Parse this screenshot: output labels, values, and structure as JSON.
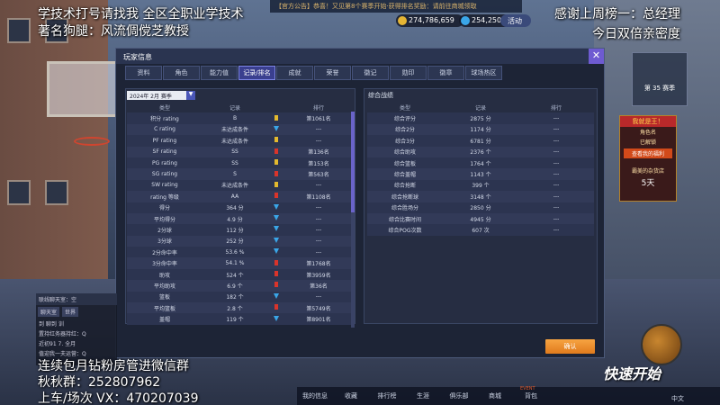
{
  "topbar": {
    "notice": "【官方公告】恭喜！又见第8个赛季开始·获得排名奖励：请前往商城领取",
    "coins": [
      {
        "value": "274,786,659"
      },
      {
        "value": "254,250"
      }
    ],
    "activity_label": "活动"
  },
  "overlays": {
    "top_left_1": "学技术打号请找我 全区全职业学技术",
    "top_left_2": "著名狗腿：风流倜傥芝教授",
    "top_right_1": "感谢上周榜一：总经理",
    "top_right_2": "今日双倍亲密度",
    "bottom_left_1": "连续包月钻粉房管进微信群",
    "bottom_left_2": "秋秋群：252807962",
    "bottom_left_3": "上车/场次 VX：470207039"
  },
  "modal": {
    "title": "玩家信息",
    "close": "✕",
    "tabs": [
      "资料",
      "角色",
      "能力值",
      "记录/排名",
      "成就",
      "荣誉",
      "徽记",
      "勋印",
      "徽章",
      "球场热区"
    ],
    "active_tab_index": 3,
    "season_select": "2024年 2月 赛季",
    "left_table": {
      "headers": [
        "类型",
        "记录",
        "排行"
      ],
      "rows": [
        {
          "type": "积分 rating",
          "record": "B",
          "indicator": "y",
          "rank": "第1061名"
        },
        {
          "type": "C rating",
          "record": "未达成条件",
          "indicator": "b",
          "rank": "---"
        },
        {
          "type": "PF rating",
          "record": "未达成条件",
          "indicator": "y",
          "rank": "---"
        },
        {
          "type": "SF rating",
          "record": "SS",
          "indicator": "r",
          "rank": "第136名"
        },
        {
          "type": "PG rating",
          "record": "SS",
          "indicator": "y",
          "rank": "第153名"
        },
        {
          "type": "SG rating",
          "record": "S",
          "indicator": "r",
          "rank": "第563名"
        },
        {
          "type": "SW rating",
          "record": "未达成条件",
          "indicator": "y",
          "rank": "---"
        },
        {
          "type": "rating 等级",
          "record": "AA",
          "indicator": "r",
          "rank": "第1108名"
        },
        {
          "type": "得分",
          "record": "364 分",
          "indicator": "b",
          "rank": "---"
        },
        {
          "type": "平均得分",
          "record": "4.9 分",
          "indicator": "b",
          "rank": "---"
        },
        {
          "type": "2分球",
          "record": "112 分",
          "indicator": "b",
          "rank": "---"
        },
        {
          "type": "3分球",
          "record": "252 分",
          "indicator": "b",
          "rank": "---"
        },
        {
          "type": "2分命中率",
          "record": "53.6 %",
          "indicator": "b",
          "rank": "---"
        },
        {
          "type": "3分命中率",
          "record": "54.1 %",
          "indicator": "r",
          "rank": "第1768名"
        },
        {
          "type": "助攻",
          "record": "524 个",
          "indicator": "r",
          "rank": "第3959名"
        },
        {
          "type": "平均助攻",
          "record": "6.9 个",
          "indicator": "r",
          "rank": "第36名"
        },
        {
          "type": "篮板",
          "record": "182 个",
          "indicator": "b",
          "rank": "---"
        },
        {
          "type": "平均篮板",
          "record": "2.8 个",
          "indicator": "r",
          "rank": "第5749名"
        },
        {
          "type": "盖帽",
          "record": "119 个",
          "indicator": "b",
          "rank": "第8901名"
        }
      ]
    },
    "right_panel_title": "综合战绩",
    "right_table": {
      "headers": [
        "类型",
        "记录",
        "排行"
      ],
      "rows": [
        {
          "type": "综合评分",
          "record": "2875 分",
          "rank": "---"
        },
        {
          "type": "综合2分",
          "record": "1174 分",
          "rank": "---"
        },
        {
          "type": "综合3分",
          "record": "6781 分",
          "rank": "---"
        },
        {
          "type": "综合助攻",
          "record": "2376 个",
          "rank": "---"
        },
        {
          "type": "综合篮板",
          "record": "1764 个",
          "rank": "---"
        },
        {
          "type": "综合盖帽",
          "record": "1143 个",
          "rank": "---"
        },
        {
          "type": "综合抢断",
          "record": "399 个",
          "rank": "---"
        },
        {
          "type": "综合抢断球",
          "record": "3148 个",
          "rank": "---"
        },
        {
          "type": "综合胜场分",
          "record": "2850 分",
          "rank": "---"
        },
        {
          "type": "综合比赛时间",
          "record": "4945 分",
          "rank": "---"
        },
        {
          "type": "综合POG次数",
          "record": "607 次",
          "rank": "---"
        }
      ]
    },
    "confirm": "确认"
  },
  "chat": {
    "title": "联线聊天室：空",
    "tabs": [
      "聊天室",
      "世界"
    ],
    "lines": [
      "到 聊到 训",
      "置持红务器持红：Q",
      "近初91 7. 全月",
      "值迎我一夫运营：Q"
    ]
  },
  "bottom_nav": [
    "我的信息",
    "收藏",
    "排行榜",
    "生涯",
    "俱乐部",
    "商城",
    "背包"
  ],
  "event_label": "EVENT",
  "right_side": {
    "season_card": "第 35 赛季",
    "promo_title": "我就是王！",
    "promo_lines": [
      "角色名",
      "已解锁",
      "查看我的福利",
      "霸美的杂货店"
    ],
    "promo_btn": "查看我的福利",
    "promo_days": "5天",
    "fast_start": "快速开始",
    "lang": "中文"
  },
  "colors": {
    "accent": "#6e5bd1",
    "confirm": "#f08d2e",
    "panel": "#262d42"
  }
}
